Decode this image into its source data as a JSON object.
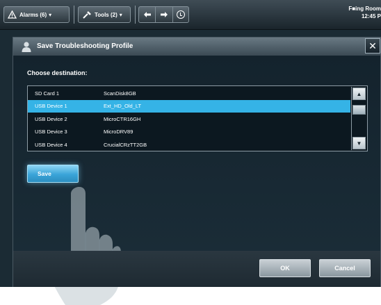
{
  "toolbar": {
    "alarms_label": "Alarms (6)",
    "tools_label": "Tools (2)",
    "room_name": "F■ing Room",
    "time": "12:45 P"
  },
  "dialog": {
    "title": "Save Troubleshooting Profile",
    "close_glyph": "✕",
    "choose_label": "Choose destination:",
    "devices": [
      {
        "name": "SD Card 1",
        "label": "ScanDisk8GB"
      },
      {
        "name": "USB Device 1",
        "label": "Ext_HD_Old_LT"
      },
      {
        "name": "USB Device 2",
        "label": "MicroCTR16GH"
      },
      {
        "name": "USB Device 3",
        "label": "MicroDRV89"
      },
      {
        "name": "USB Device 4",
        "label": "CrucialCRzTT2GB"
      }
    ],
    "selected_index": 1,
    "save_label": "Save",
    "ok_label": "OK",
    "cancel_label": "Cancel"
  },
  "icons": {
    "alarm": "warning-triangle-icon",
    "tools": "wrench-icon",
    "back": "arrow-left-icon",
    "forward": "arrow-right-icon",
    "clock": "clock-icon",
    "user": "user-icon",
    "scroll_up": "scroll-up-icon",
    "scroll_down": "scroll-down-icon",
    "hand": "pointing-hand-icon"
  },
  "colors": {
    "selection": "#35b3e6",
    "save_button": "#3aa4d8",
    "dialog_bg": "#0f1d26"
  }
}
